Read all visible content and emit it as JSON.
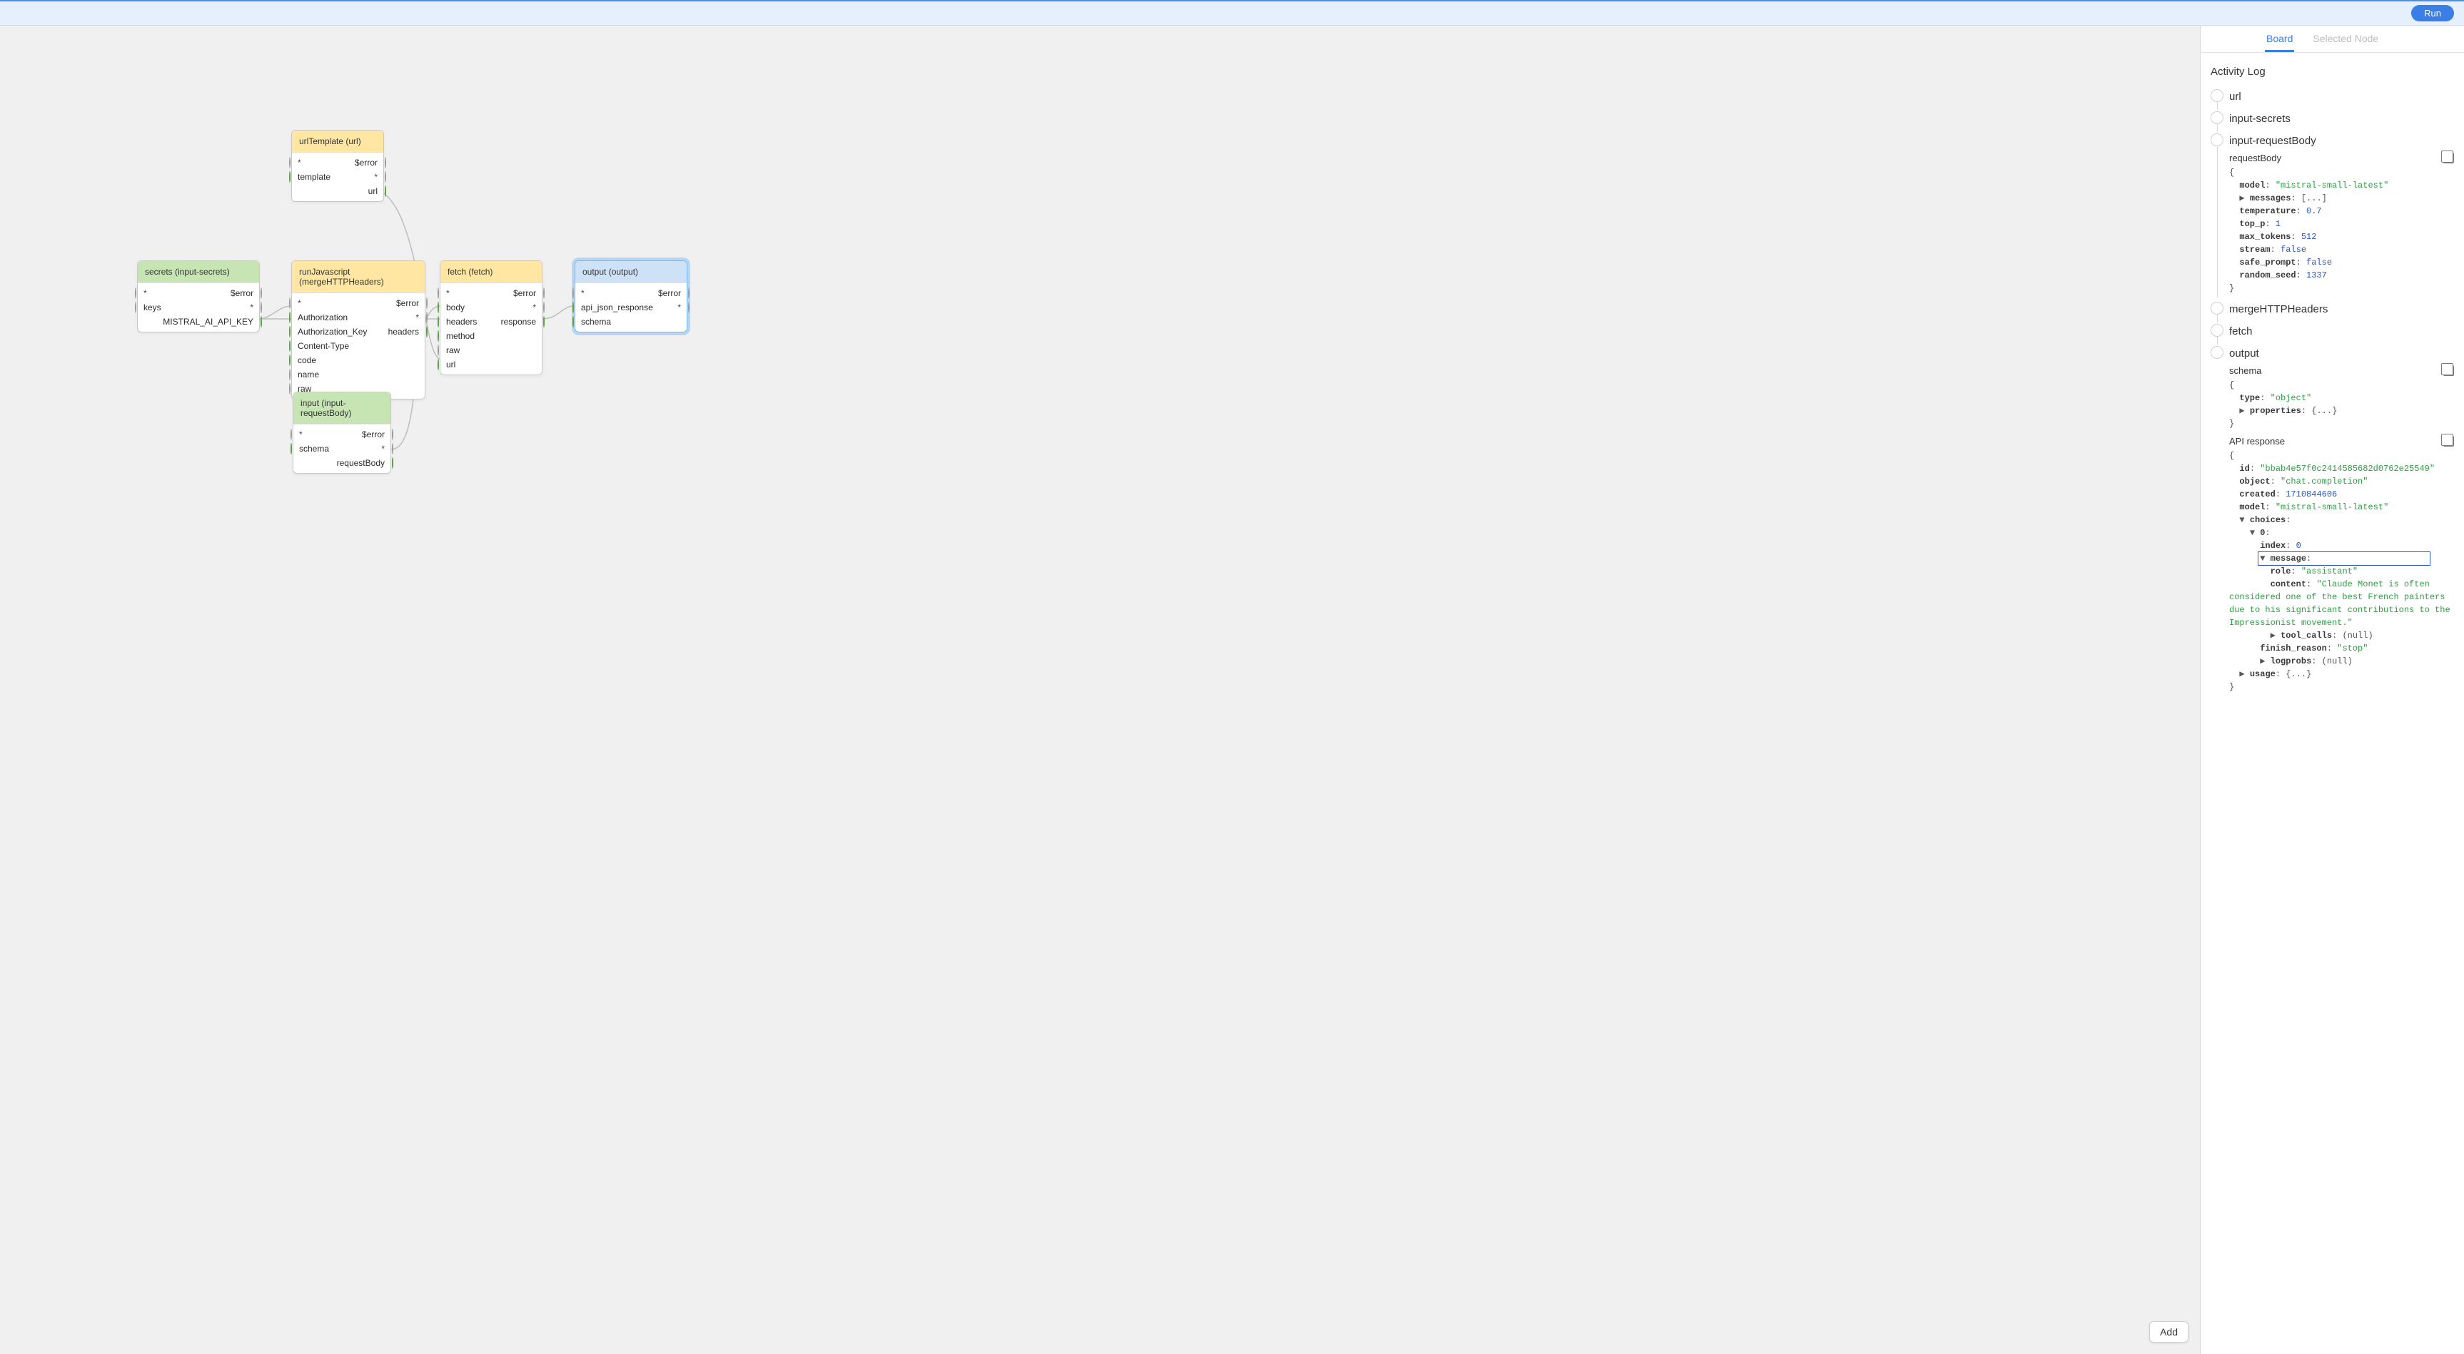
{
  "topbar": {
    "run_label": "Run"
  },
  "tabs": {
    "board": "Board",
    "selected_node": "Selected Node"
  },
  "activity_log_heading": "Activity Log",
  "canvas": {
    "add_button_label": "Add",
    "nodes": {
      "urlTemplate": {
        "title": "urlTemplate (url)",
        "star": "*",
        "error": "$error",
        "template": "template",
        "url_out": "url"
      },
      "secrets": {
        "title": "secrets (input-secrets)",
        "star": "*",
        "error": "$error",
        "keys": "keys",
        "api_key": "MISTRAL_AI_API_KEY"
      },
      "runJavascript": {
        "title": "runJavascript (mergeHTTPHeaders)",
        "star": "*",
        "error": "$error",
        "auth": "Authorization",
        "auth_key": "Authorization_Key",
        "content_type": "Content-Type",
        "code": "code",
        "name": "name",
        "raw": "raw",
        "headers_out": "headers"
      },
      "input": {
        "title": "input (input-requestBody)",
        "star": "*",
        "error": "$error",
        "schema": "schema",
        "request_body_out": "requestBody"
      },
      "fetch": {
        "title": "fetch (fetch)",
        "star": "*",
        "error": "$error",
        "body": "body",
        "headers": "headers",
        "method": "method",
        "raw": "raw",
        "url": "url",
        "response_out": "response"
      },
      "output": {
        "title": "output (output)",
        "star": "*",
        "error": "$error",
        "api_json": "api_json_response",
        "schema": "schema"
      }
    }
  },
  "log": {
    "url": {
      "title": "url"
    },
    "input_secrets": {
      "title": "input-secrets"
    },
    "input_request_body": {
      "title": "input-requestBody",
      "section_label": "requestBody",
      "body": {
        "model": "mistral-small-latest",
        "messages_collapsed": "[...]",
        "temperature": 0.7,
        "top_p": 1,
        "max_tokens": 512,
        "stream": false,
        "safe_prompt": false,
        "random_seed": 1337
      }
    },
    "merge": {
      "title": "mergeHTTPHeaders"
    },
    "fetch": {
      "title": "fetch"
    },
    "output": {
      "title": "output",
      "schema_label": "schema",
      "schema": {
        "type": "object",
        "properties_collapsed": "{...}"
      },
      "api_response_label": "API response",
      "api": {
        "id": "bbab4e57f0c2414585682d0762e25549",
        "object": "chat.completion",
        "created": 1710844606,
        "model": "mistral-small-latest",
        "choice_index": 0,
        "message_role": "assistant",
        "message_content": "Claude Monet is often considered one of the best French painters due to his significant contributions to the Impressionist movement.",
        "tool_calls": "(null)",
        "finish_reason": "stop",
        "logprobs": "(null)",
        "usage_collapsed": "{...}"
      }
    }
  }
}
